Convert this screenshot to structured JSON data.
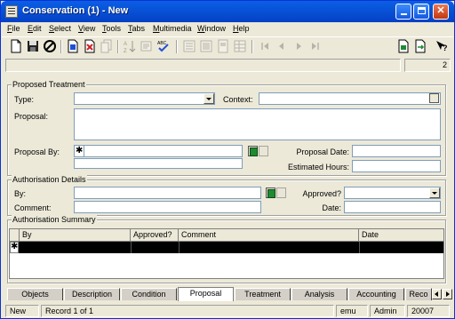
{
  "window": {
    "title": "Conservation (1) - New"
  },
  "menu": [
    "File",
    "Edit",
    "Select",
    "View",
    "Tools",
    "Tabs",
    "Multimedia",
    "Window",
    "Help"
  ],
  "record": {
    "count": "2"
  },
  "proposed_treatment": {
    "legend": "Proposed Treatment",
    "type_label": "Type:",
    "type_value": "",
    "context_label": "Context:",
    "context_value": "",
    "proposal_label": "Proposal:",
    "proposal_value": "",
    "proposal_by_label": "Proposal By:",
    "proposal_by_marker": "✱",
    "proposal_date_label": "Proposal Date:",
    "estimated_hours_label": "Estimated Hours:"
  },
  "authorisation_details": {
    "legend": "Authorisation Details",
    "by_label": "By:",
    "approved_label": "Approved?",
    "comment_label": "Comment:",
    "date_label": "Date:"
  },
  "authorisation_summary": {
    "legend": "Authorisation Summary",
    "columns": [
      "By",
      "Approved?",
      "Comment",
      "Date"
    ],
    "new_row_marker": "✱"
  },
  "tabs": [
    "Objects",
    "Description",
    "Condition",
    "Proposal",
    "Treatment",
    "Analysis",
    "Accounting",
    "Reco"
  ],
  "active_tab": "Proposal",
  "status": {
    "mode": "New",
    "record": "Record 1 of 1",
    "user_db": "emu",
    "user": "Admin",
    "code": "20007"
  },
  "icons": {
    "toolbar": [
      "new-icon",
      "save-icon",
      "cancel-icon",
      "insert-icon",
      "delete-icon",
      "copy-icon",
      "sort-icon",
      "edit-icon",
      "spellcheck-icon",
      "form-view-icon",
      "list-view-icon",
      "page-view-icon",
      "table-view-icon",
      "first-record-icon",
      "previous-record-icon",
      "next-record-icon",
      "last-record-icon",
      "report-icon",
      "export-icon",
      "help-icon"
    ]
  },
  "colors": {
    "title_bar": "#0853d8",
    "window_bg": "#ece9d8",
    "field_border": "#7f9db9"
  }
}
